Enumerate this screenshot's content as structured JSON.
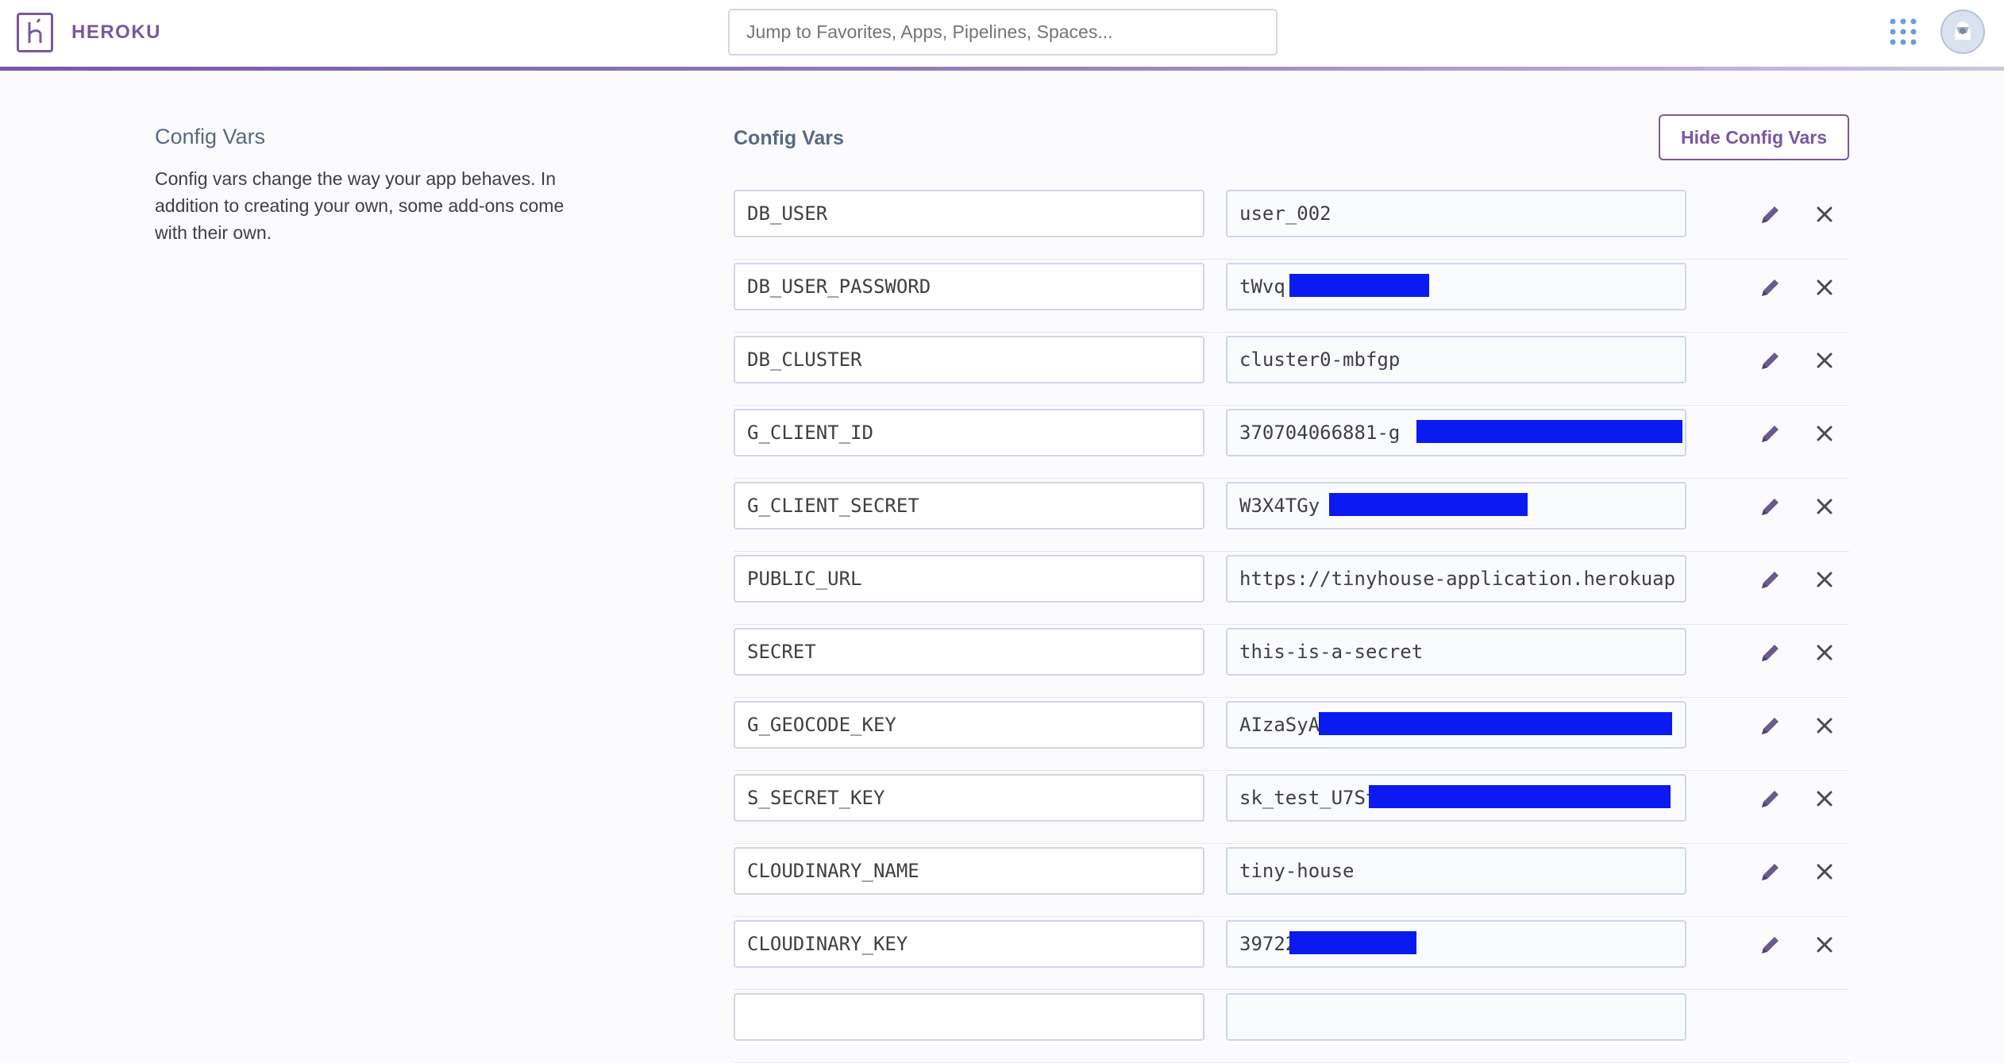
{
  "header": {
    "brand": "HEROKU",
    "logo_icon": "heroku-logo-icon",
    "search_placeholder": "Jump to Favorites, Apps, Pipelines, Spaces...",
    "apps_icon": "grid-apps-icon",
    "avatar_icon": "user-avatar-icon",
    "accent_color": "#79589f"
  },
  "sidebar": {
    "title": "Config Vars",
    "description": "Config vars change the way your app behaves. In addition to creating your own, some add-ons come with their own."
  },
  "main": {
    "title": "Config Vars",
    "hide_button": "Hide Config Vars",
    "redaction_color": "#0a1af0",
    "vars": [
      {
        "key": "DB_USER",
        "value": "user_002",
        "redacted": false
      },
      {
        "key": "DB_USER_PASSWORD",
        "value": "tWvq",
        "redacted": true
      },
      {
        "key": "DB_CLUSTER",
        "value": "cluster0-mbfgp",
        "redacted": false
      },
      {
        "key": "G_CLIENT_ID",
        "value": "370704066881-g",
        "redacted": true
      },
      {
        "key": "G_CLIENT_SECRET",
        "value": "W3X4TGy",
        "redacted": true
      },
      {
        "key": "PUBLIC_URL",
        "value": "https://tinyhouse-application.herokuap",
        "redacted": false
      },
      {
        "key": "SECRET",
        "value": "this-is-a-secret",
        "redacted": false
      },
      {
        "key": "G_GEOCODE_KEY",
        "value": "AIzaSyA",
        "redacted": true
      },
      {
        "key": "S_SECRET_KEY",
        "value": "sk_test_U7St",
        "redacted": true
      },
      {
        "key": "CLOUDINARY_NAME",
        "value": "tiny-house",
        "redacted": false
      },
      {
        "key": "CLOUDINARY_KEY",
        "value": "39722",
        "redacted": true
      },
      {
        "key": "",
        "value": "",
        "redacted": false
      }
    ],
    "edit_icon": "pencil-edit-icon",
    "delete_icon": "close-x-icon"
  }
}
